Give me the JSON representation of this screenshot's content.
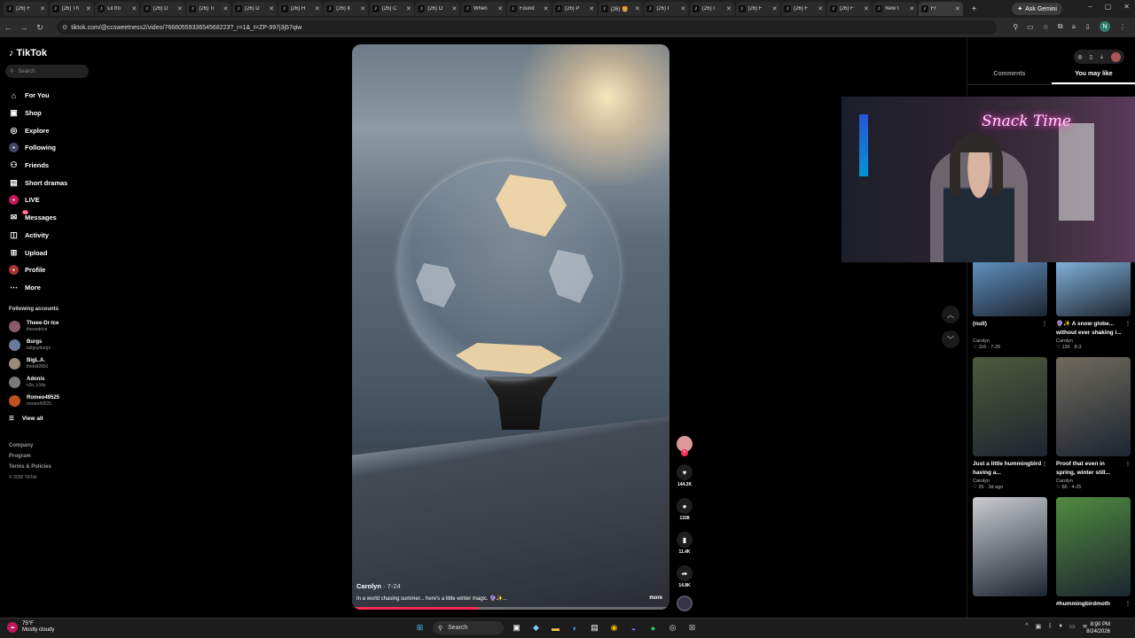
{
  "browser": {
    "tabs": [
      {
        "label": "(26) F"
      },
      {
        "label": "(26) Th"
      },
      {
        "label": "Lil fro"
      },
      {
        "label": "(26) D"
      },
      {
        "label": "(26) Ti"
      },
      {
        "label": "(26) D"
      },
      {
        "label": "(26) H"
      },
      {
        "label": "(26) It"
      },
      {
        "label": "(26) C"
      },
      {
        "label": "(26) O"
      },
      {
        "label": "When"
      },
      {
        "label": "Found"
      },
      {
        "label": "(26) P"
      },
      {
        "label": "(26) 🍔"
      },
      {
        "label": "(26) I"
      },
      {
        "label": "(26) I"
      },
      {
        "label": "(26) F"
      },
      {
        "label": "(26) F"
      },
      {
        "label": "(26) F"
      },
      {
        "label": "New t"
      },
      {
        "label": "Fr"
      }
    ],
    "ask_gemini": "Ask Gemini",
    "url": "tiktok.com/@ccsweetness2/video/7666055933654568223?_r=1&_t=ZP-997j3j57qiw",
    "profile_initial": "N"
  },
  "sidebar": {
    "logo": "TikTok",
    "search_placeholder": "Search",
    "nav": [
      {
        "label": "For You",
        "icon": "home-icon"
      },
      {
        "label": "Shop",
        "icon": "shop-icon"
      },
      {
        "label": "Explore",
        "icon": "compass-icon"
      },
      {
        "label": "Following",
        "icon": "following-icon"
      },
      {
        "label": "Friends",
        "icon": "friends-icon"
      },
      {
        "label": "Short dramas",
        "icon": "drama-icon"
      },
      {
        "label": "LIVE",
        "icon": "live-icon"
      },
      {
        "label": "Messages",
        "icon": "messages-icon",
        "badge": "99"
      },
      {
        "label": "Activity",
        "icon": "activity-icon"
      },
      {
        "label": "Upload",
        "icon": "upload-icon"
      },
      {
        "label": "Profile",
        "icon": "profile-icon"
      },
      {
        "label": "More",
        "icon": "more-icon"
      }
    ],
    "following_title": "Following accounts",
    "following": [
      {
        "name": "Theee-Dr-Ice",
        "handle": "theeedrice"
      },
      {
        "name": "Burgs",
        "handle": "tallguyburgz"
      },
      {
        "name": "BigL.A.",
        "handle": "thekid2891"
      },
      {
        "name": "Adonis",
        "handle": "n3o_k1tty"
      },
      {
        "name": "Romeo49525",
        "handle": "romeo49525"
      }
    ],
    "view_all": "View all",
    "footer": {
      "company": "Company",
      "program": "Program",
      "terms": "Terms & Policies",
      "copyright": "© 2026 TikTok"
    }
  },
  "video": {
    "author": "Carolyn",
    "date": "· 7-24",
    "description": "In a world chasing summer... here's a little winter magic. 🔮✨...",
    "more": "more",
    "progress": 0.4
  },
  "actions": {
    "likes": "144.2K",
    "comments": "1338",
    "saves": "11.4K",
    "shares": "14.8K"
  },
  "right_panel": {
    "tab_comments": "Comments",
    "tab_you_may_like": "You may like",
    "webcam_sign": "Snack Time",
    "thumbs": [
      {
        "title": "(null)",
        "author": "Carolyn",
        "stats": "♡ 116 · 7-25",
        "color": "#5f8fbf"
      },
      {
        "title": "🔮✨ A snow globe... without ever shaking i...",
        "author": "Carolyn",
        "stats": "♡ 136 · 8-3",
        "color": "#7fb0d8"
      },
      {
        "title": "Just a little hummingbird having a...",
        "author": "Carolyn",
        "stats": "♡ 26 · 3d ago",
        "color": "#4d5a3a"
      },
      {
        "title": "Proof that even in spring, winter still...",
        "author": "Carolyn",
        "stats": "♡ 66 · 4-25",
        "color": "#6f6a5d"
      },
      {
        "title": "",
        "author": "",
        "stats": "",
        "color": "#c9ccd0"
      },
      {
        "title": "#hummingbirdmoth",
        "author": "",
        "stats": "",
        "color": "#4f8a3e"
      }
    ]
  },
  "taskbar": {
    "temp": "75°F",
    "weather": "Mostly cloudy",
    "search": "Search",
    "time": "8:00 PM",
    "date": "8/24/2026"
  }
}
